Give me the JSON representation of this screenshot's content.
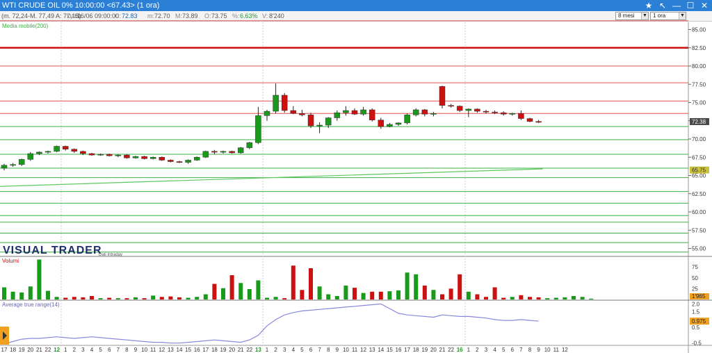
{
  "window": {
    "title": "WTI CRUDE OIL 0%  10:00:00   <67.43>  (1 ora)",
    "buttons": {
      "star": "★",
      "pin": "↖",
      "minimize": "—",
      "maximize": "☐",
      "close": "✕"
    }
  },
  "infobar": {
    "range": "(m. 72,24-M. 77,49 A: 77,15)",
    "date_label": "Data:",
    "date_value": "16/06 09:00:00",
    "close_label": "C:",
    "close_value": "72.83",
    "min_label": "m:",
    "min_value": "72.70",
    "max_label": "M:",
    "max_value": "73.89",
    "open_label": "O:",
    "open_value": "73.75",
    "change_label": "%:",
    "change_value": "6.63%",
    "volume_label": "V:",
    "volume_value": "8'240",
    "period_select": "8 mesi",
    "timeframe_select": "1 ora"
  },
  "panels": {
    "price_indicator_label": "Media mobile(200)",
    "volume_label": "Volumi",
    "atr_label": "Average true range(14)",
    "brand": "VISUAL TRADER",
    "brand_sub": "Dati Intraday"
  },
  "colors": {
    "up": "#1a9a1a",
    "down": "#cc1111",
    "resistance": "#e05050",
    "support": "#3cb043",
    "ma": "#5cc85c",
    "atr": "#8888dd",
    "axis_text": "#333333"
  },
  "price_axis": {
    "min": 54,
    "max": 86,
    "ticks": [
      "85.00",
      "82.50",
      "80.00",
      "77.50",
      "75.00",
      "72.50",
      "70.00",
      "67.50",
      "65.00",
      "62.50",
      "60.00",
      "57.50",
      "55.00"
    ],
    "tick_values": [
      85,
      82.5,
      80,
      77.5,
      75,
      72.5,
      70,
      67.5,
      65,
      62.5,
      60,
      57.5,
      55
    ],
    "current_price_label": "72.38",
    "current_price": 72.38,
    "ma_label": "65.75",
    "ma_value": 65.75
  },
  "levels": {
    "resistance": [
      86.2,
      80.0,
      77.7,
      75.2,
      73.5
    ],
    "strong_resistance": 82.5,
    "support": [
      71.7,
      69.9,
      67.9,
      66.0,
      64.7,
      62.8,
      61.2,
      59.5,
      58.6,
      57.1,
      55.8,
      54.5
    ]
  },
  "moving_average": {
    "start": 63.5,
    "end": 65.9
  },
  "chart_data": {
    "type": "candlestick",
    "title": "WTI CRUDE OIL 0%",
    "x_labels": [
      "17",
      "18",
      "19",
      "20",
      "21",
      "22",
      "12",
      "1",
      "2",
      "3",
      "4",
      "5",
      "6",
      "7",
      "8",
      "9",
      "10",
      "11",
      "12",
      "13",
      "14",
      "15",
      "16",
      "17",
      "18",
      "19",
      "20",
      "21",
      "22",
      "13",
      "1",
      "2",
      "3",
      "4",
      "5",
      "6",
      "7",
      "8",
      "9",
      "10",
      "11",
      "12",
      "13",
      "14",
      "15",
      "16",
      "17",
      "18",
      "19",
      "20",
      "21",
      "22",
      "16",
      "1",
      "2",
      "3",
      "4",
      "5",
      "6",
      "7",
      "8",
      "9",
      "10",
      "11",
      "12"
    ],
    "x_label_highlight": [
      "12",
      "13",
      "16"
    ],
    "candles": [
      {
        "o": 66.0,
        "h": 66.6,
        "l": 65.7,
        "c": 66.4
      },
      {
        "o": 66.4,
        "h": 66.7,
        "l": 66.2,
        "c": 66.5
      },
      {
        "o": 66.5,
        "h": 67.3,
        "l": 66.3,
        "c": 67.2
      },
      {
        "o": 67.2,
        "h": 68.2,
        "l": 67.0,
        "c": 68.0
      },
      {
        "o": 68.0,
        "h": 68.3,
        "l": 67.8,
        "c": 68.2
      },
      {
        "o": 68.2,
        "h": 68.4,
        "l": 68.0,
        "c": 68.3
      },
      {
        "o": 68.3,
        "h": 69.1,
        "l": 68.2,
        "c": 69.0
      },
      {
        "o": 69.0,
        "h": 69.1,
        "l": 68.4,
        "c": 68.6
      },
      {
        "o": 68.6,
        "h": 68.7,
        "l": 68.1,
        "c": 68.3
      },
      {
        "o": 68.3,
        "h": 68.4,
        "l": 67.8,
        "c": 68.0
      },
      {
        "o": 68.0,
        "h": 68.1,
        "l": 67.7,
        "c": 67.8
      },
      {
        "o": 67.8,
        "h": 68.0,
        "l": 67.7,
        "c": 67.9
      },
      {
        "o": 67.9,
        "h": 68.0,
        "l": 67.6,
        "c": 67.7
      },
      {
        "o": 67.7,
        "h": 67.9,
        "l": 67.5,
        "c": 67.8
      },
      {
        "o": 67.8,
        "h": 67.9,
        "l": 67.3,
        "c": 67.4
      },
      {
        "o": 67.4,
        "h": 67.7,
        "l": 67.3,
        "c": 67.6
      },
      {
        "o": 67.6,
        "h": 67.7,
        "l": 67.2,
        "c": 67.3
      },
      {
        "o": 67.3,
        "h": 67.6,
        "l": 67.2,
        "c": 67.5
      },
      {
        "o": 67.5,
        "h": 67.6,
        "l": 67.0,
        "c": 67.1
      },
      {
        "o": 67.1,
        "h": 67.2,
        "l": 66.8,
        "c": 66.9
      },
      {
        "o": 66.9,
        "h": 67.0,
        "l": 66.7,
        "c": 66.8
      },
      {
        "o": 66.8,
        "h": 67.2,
        "l": 66.6,
        "c": 67.1
      },
      {
        "o": 67.1,
        "h": 67.6,
        "l": 67.0,
        "c": 67.5
      },
      {
        "o": 67.5,
        "h": 68.4,
        "l": 67.4,
        "c": 68.3
      },
      {
        "o": 68.3,
        "h": 68.5,
        "l": 67.9,
        "c": 68.2
      },
      {
        "o": 68.2,
        "h": 68.4,
        "l": 68.0,
        "c": 68.3
      },
      {
        "o": 68.3,
        "h": 68.4,
        "l": 68.0,
        "c": 68.1
      },
      {
        "o": 68.1,
        "h": 68.9,
        "l": 68.0,
        "c": 68.8
      },
      {
        "o": 68.8,
        "h": 69.6,
        "l": 68.6,
        "c": 69.5
      },
      {
        "o": 69.5,
        "h": 74.4,
        "l": 69.3,
        "c": 73.2
      },
      {
        "o": 73.2,
        "h": 74.0,
        "l": 72.5,
        "c": 73.8
      },
      {
        "o": 73.8,
        "h": 77.6,
        "l": 73.5,
        "c": 76.0
      },
      {
        "o": 76.0,
        "h": 76.3,
        "l": 73.6,
        "c": 73.9
      },
      {
        "o": 73.9,
        "h": 74.5,
        "l": 73.4,
        "c": 73.5
      },
      {
        "o": 73.5,
        "h": 74.0,
        "l": 73.1,
        "c": 73.3
      },
      {
        "o": 73.3,
        "h": 73.6,
        "l": 71.5,
        "c": 71.8
      },
      {
        "o": 71.8,
        "h": 72.3,
        "l": 70.8,
        "c": 71.9
      },
      {
        "o": 71.9,
        "h": 73.0,
        "l": 71.5,
        "c": 72.9
      },
      {
        "o": 72.9,
        "h": 73.9,
        "l": 72.5,
        "c": 73.6
      },
      {
        "o": 73.6,
        "h": 74.5,
        "l": 73.2,
        "c": 73.9
      },
      {
        "o": 73.9,
        "h": 74.2,
        "l": 73.3,
        "c": 73.4
      },
      {
        "o": 73.4,
        "h": 74.4,
        "l": 73.2,
        "c": 74.0
      },
      {
        "o": 74.0,
        "h": 74.2,
        "l": 72.4,
        "c": 72.6
      },
      {
        "o": 72.6,
        "h": 72.9,
        "l": 71.4,
        "c": 71.7
      },
      {
        "o": 71.7,
        "h": 72.2,
        "l": 71.6,
        "c": 72.0
      },
      {
        "o": 72.0,
        "h": 72.3,
        "l": 71.8,
        "c": 72.2
      },
      {
        "o": 72.2,
        "h": 73.5,
        "l": 72.0,
        "c": 73.3
      },
      {
        "o": 73.3,
        "h": 74.2,
        "l": 73.1,
        "c": 74.0
      },
      {
        "o": 74.0,
        "h": 74.1,
        "l": 73.1,
        "c": 73.4
      },
      {
        "o": 73.4,
        "h": 73.7,
        "l": 73.1,
        "c": 73.5
      },
      {
        "o": 77.2,
        "h": 77.3,
        "l": 74.2,
        "c": 74.6
      },
      {
        "o": 74.6,
        "h": 74.8,
        "l": 74.3,
        "c": 74.5
      },
      {
        "o": 74.5,
        "h": 74.6,
        "l": 73.7,
        "c": 73.9
      },
      {
        "o": 73.9,
        "h": 74.2,
        "l": 73.0,
        "c": 74.1
      },
      {
        "o": 74.1,
        "h": 74.2,
        "l": 73.6,
        "c": 73.8
      },
      {
        "o": 73.8,
        "h": 74.0,
        "l": 73.5,
        "c": 73.7
      },
      {
        "o": 73.7,
        "h": 73.9,
        "l": 73.4,
        "c": 73.6
      },
      {
        "o": 73.6,
        "h": 73.8,
        "l": 73.2,
        "c": 73.4
      },
      {
        "o": 73.4,
        "h": 73.6,
        "l": 73.2,
        "c": 73.5
      },
      {
        "o": 73.5,
        "h": 73.9,
        "l": 72.6,
        "c": 72.8
      },
      {
        "o": 72.8,
        "h": 72.9,
        "l": 72.3,
        "c": 72.4
      },
      {
        "o": 72.4,
        "h": 72.6,
        "l": 72.2,
        "c": 72.38
      }
    ],
    "volume": {
      "ticks": [
        "75",
        "50",
        "25"
      ],
      "tick_values": [
        75,
        50,
        25
      ],
      "max": 96,
      "last_label": "1'965",
      "bars": [
        28,
        18,
        16,
        30,
        92,
        20,
        6,
        4,
        6,
        5,
        8,
        3,
        4,
        3,
        3,
        5,
        3,
        9,
        6,
        7,
        5,
        4,
        6,
        12,
        36,
        26,
        56,
        38,
        24,
        44,
        4,
        6,
        3,
        78,
        22,
        72,
        30,
        12,
        8,
        32,
        27,
        15,
        18,
        18,
        19,
        21,
        62,
        58,
        32,
        22,
        12,
        25,
        58,
        18,
        12,
        6,
        28,
        4,
        6,
        10,
        6,
        5,
        3,
        4,
        5,
        8,
        6,
        2
      ]
    },
    "atr": {
      "ticks": [
        "2.0",
        "1.5",
        "1.0",
        "0.5",
        "-0.5"
      ],
      "tick_values": [
        2.0,
        1.5,
        1.0,
        0.5,
        -0.5
      ],
      "min": -0.6,
      "max": 2.15,
      "last_label": "0.975",
      "values": [
        -0.55,
        -0.4,
        -0.25,
        -0.2,
        -0.2,
        -0.15,
        -0.1,
        -0.15,
        -0.2,
        -0.15,
        -0.1,
        -0.15,
        -0.2,
        -0.25,
        -0.3,
        -0.35,
        -0.4,
        -0.45,
        -0.45,
        -0.5,
        -0.5,
        -0.45,
        -0.4,
        -0.35,
        -0.3,
        -0.35,
        -0.4,
        -0.45,
        -0.3,
        0.0,
        0.6,
        1.0,
        1.3,
        1.45,
        1.55,
        1.6,
        1.65,
        1.7,
        1.75,
        1.8,
        1.85,
        1.9,
        1.95,
        2.0,
        1.7,
        1.4,
        1.3,
        1.25,
        1.2,
        1.15,
        1.3,
        1.25,
        1.2,
        1.2,
        1.15,
        1.1,
        1.0,
        0.95,
        0.95,
        1.0,
        0.95,
        0.9
      ]
    }
  }
}
